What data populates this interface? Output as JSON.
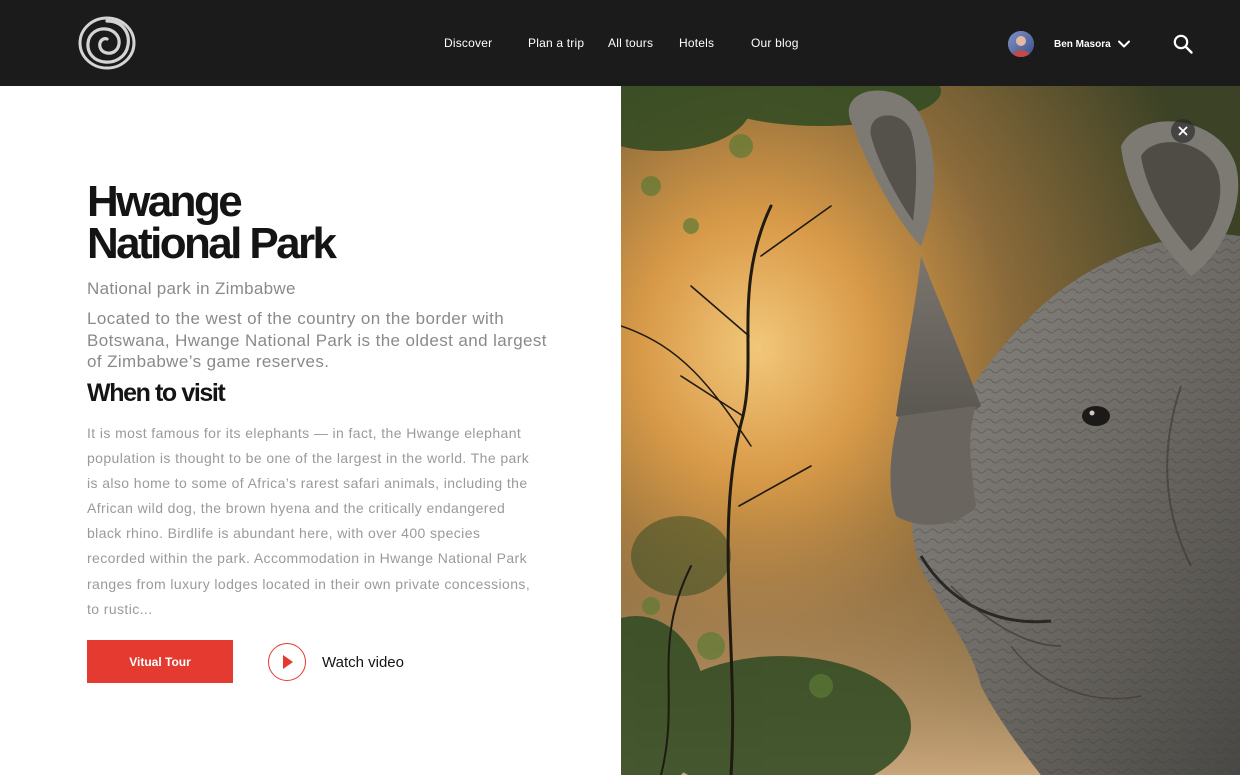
{
  "header": {
    "logo_icon": "spiral-logo-icon",
    "nav": [
      {
        "label": "Discover"
      },
      {
        "label": "Plan a trip"
      },
      {
        "label": "All tours"
      },
      {
        "label": "Hotels"
      },
      {
        "label": "Our blog"
      }
    ],
    "user": {
      "name": "Ben Masora",
      "avatar_icon": "user-avatar",
      "menu_icon": "chevron-down-icon"
    },
    "search_icon": "search-icon"
  },
  "main": {
    "title_line1": "Hwange",
    "title_line2": "National Park",
    "subtitle": "National park in Zimbabwe",
    "lede": "Located to the west of the country on the border with Botswana, Hwange National Park is the oldest and largest of Zimbabwe’s game reserves.",
    "section_heading": "When to visit",
    "body": "It is most famous for its elephants — in fact, the Hwange elephant population is thought to be one of the largest in the world. The park is also home to some of Africa’s rarest safari animals, including the African wild dog, the brown hyena and the critically endangered black rhino. Birdlife is abundant here, with over 400 species recorded within the park. Accommodation in Hwange National Park ranges from luxury lodges located in their own private concessions, to rustic...",
    "primary_button": "Vitual Tour",
    "video_label": "Watch video",
    "play_icon": "play-icon"
  },
  "hero": {
    "image_icon": "rhino-photo",
    "close_icon": "close-icon"
  },
  "colors": {
    "header_bg": "#1b1b1b",
    "accent": "#e53a2f",
    "heading": "#141414",
    "muted_text": "#8a8a8a"
  }
}
